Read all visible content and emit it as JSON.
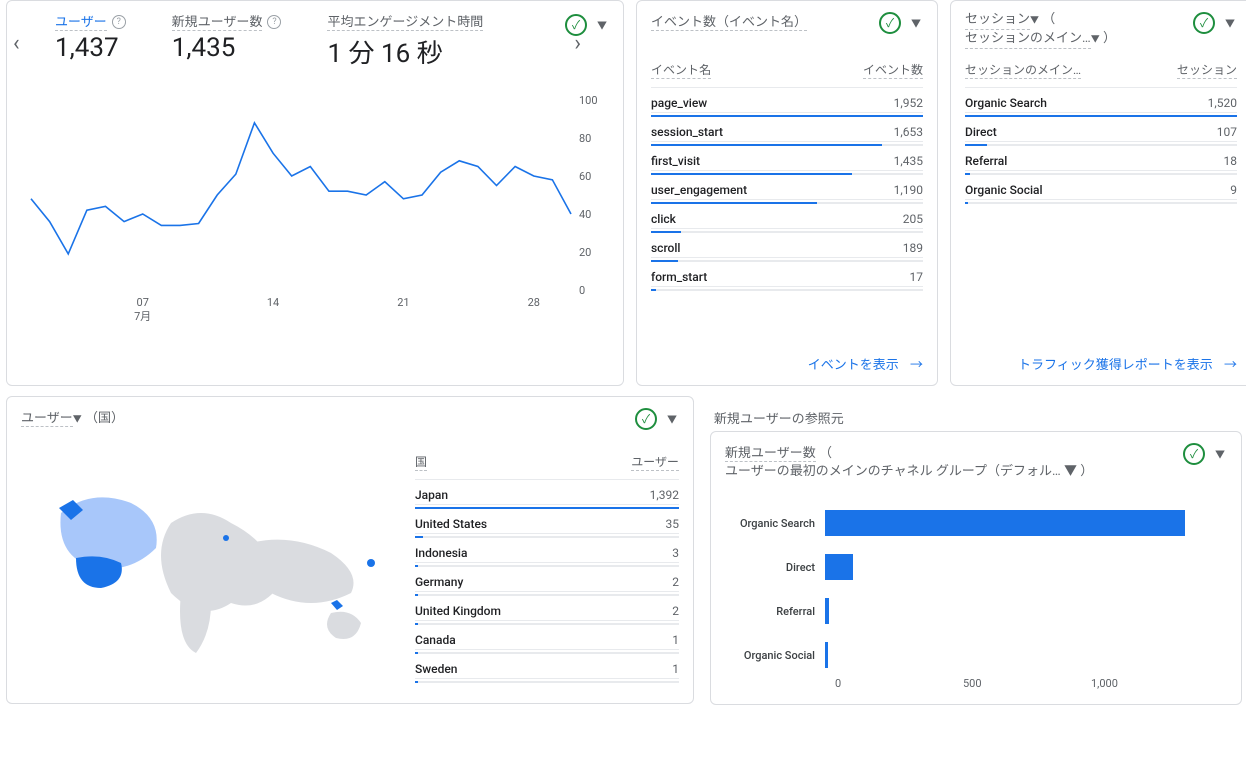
{
  "status": {
    "check": "✓",
    "caret": "▼"
  },
  "nav": {
    "left": "‹",
    "right": "›"
  },
  "help": "?",
  "scorecards": [
    {
      "label": "ユーザー",
      "value": "1,437",
      "active": true,
      "help": true
    },
    {
      "label": "新規ユーザー数",
      "value": "1,435",
      "active": false,
      "help": true
    },
    {
      "label": "平均エンゲージメント時間",
      "value": "1 分 16 秒",
      "active": false,
      "help": false
    }
  ],
  "chart_data": {
    "type": "line",
    "ylabel": "",
    "ylim": [
      0,
      100
    ],
    "yticks": [
      0,
      20,
      40,
      60,
      80,
      100
    ],
    "xticks": [
      "07",
      "14",
      "21",
      "28"
    ],
    "xsub": "7月",
    "values": [
      48,
      36,
      19,
      42,
      44,
      36,
      40,
      34,
      34,
      35,
      50,
      61,
      88,
      72,
      60,
      65,
      52,
      52,
      50,
      57,
      48,
      50,
      62,
      68,
      65,
      55,
      65,
      60,
      58,
      40
    ]
  },
  "events_card": {
    "title": "イベント数（イベント名）",
    "cols": [
      "イベント名",
      "イベント数"
    ],
    "rows": [
      {
        "name": "page_view",
        "value": "1,952",
        "pct": 100
      },
      {
        "name": "session_start",
        "value": "1,653",
        "pct": 85
      },
      {
        "name": "first_visit",
        "value": "1,435",
        "pct": 74
      },
      {
        "name": "user_engagement",
        "value": "1,190",
        "pct": 61
      },
      {
        "name": "click",
        "value": "205",
        "pct": 11
      },
      {
        "name": "scroll",
        "value": "189",
        "pct": 10
      },
      {
        "name": "form_start",
        "value": "17",
        "pct": 2
      }
    ],
    "link": "イベントを表示"
  },
  "sessions_card": {
    "title_a": "セッション",
    "title_b": "（",
    "title_c": "セッションのメイン…",
    "title_d": "）",
    "cols": [
      "セッションのメイン…",
      "セッション"
    ],
    "rows": [
      {
        "name": "Organic Search",
        "value": "1,520",
        "pct": 100
      },
      {
        "name": "Direct",
        "value": "107",
        "pct": 8
      },
      {
        "name": "Referral",
        "value": "18",
        "pct": 2
      },
      {
        "name": "Organic Social",
        "value": "9",
        "pct": 1
      }
    ],
    "link": "トラフィック獲得レポートを表示"
  },
  "section2_title": "新規ユーザーの参照元",
  "geo_card": {
    "title": "ユーザー",
    "title_suffix": "（国）",
    "cols": [
      "国",
      "ユーザー"
    ],
    "rows": [
      {
        "name": "Japan",
        "value": "1,392",
        "pct": 100
      },
      {
        "name": "United States",
        "value": "35",
        "pct": 3
      },
      {
        "name": "Indonesia",
        "value": "3",
        "pct": 1
      },
      {
        "name": "Germany",
        "value": "2",
        "pct": 1
      },
      {
        "name": "United Kingdom",
        "value": "2",
        "pct": 1
      },
      {
        "name": "Canada",
        "value": "1",
        "pct": 1
      },
      {
        "name": "Sweden",
        "value": "1",
        "pct": 1
      }
    ]
  },
  "bar_card": {
    "title1": "新規ユーザー数",
    "title_open": "（",
    "title2": "ユーザーの最初のメインのチャネル グループ（デフォル…",
    "title_close": "）",
    "chart_data": {
      "type": "bar",
      "xlim": [
        0,
        1300
      ],
      "xticks": [
        "0",
        "500",
        "1,000"
      ],
      "categories": [
        "Organic Search",
        "Direct",
        "Referral",
        "Organic Social"
      ],
      "values": [
        1300,
        100,
        15,
        10
      ]
    }
  },
  "arrow": "→"
}
